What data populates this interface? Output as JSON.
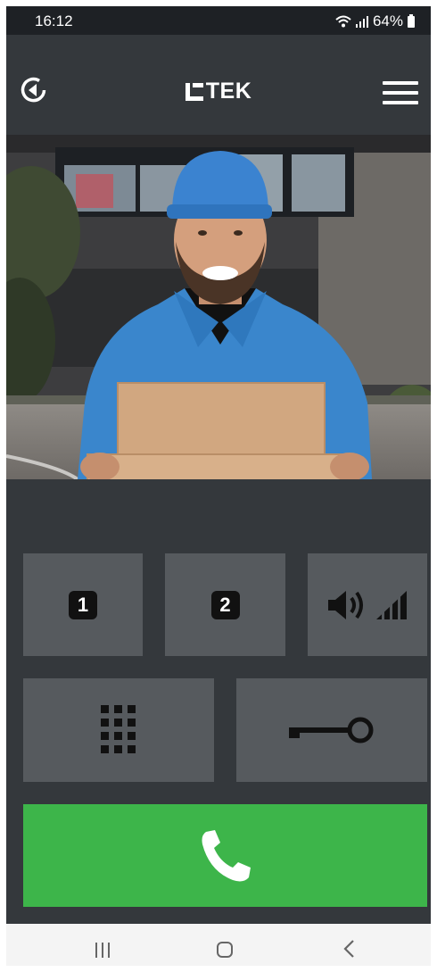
{
  "status_bar": {
    "time": "16:12",
    "battery": "64%"
  },
  "app": {
    "brand": "TEK"
  },
  "icons": {
    "back": "back-circle-icon",
    "menu": "hamburger-menu-icon",
    "output1": "output-1-icon",
    "output2": "output-2-icon",
    "volume": "volume-level-icon",
    "keypad": "keypad-icon",
    "door": "door-key-icon",
    "call": "phone-handset-icon"
  },
  "buttons": {
    "output1_label": "1",
    "output2_label": "2"
  },
  "colors": {
    "background": "#34383c",
    "button": "#565a5e",
    "call": "#3db54a",
    "status_bar": "#1e2125"
  }
}
